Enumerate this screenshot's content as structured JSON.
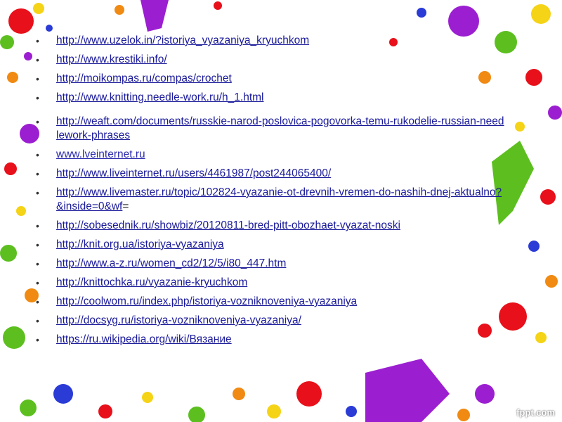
{
  "links": [
    {
      "text": "http://www.uzelok.in/?istoriya_vyazaniya_kryuchkom",
      "suffix": ""
    },
    {
      "text": "http://www.krestiki.info/",
      "suffix": ""
    },
    {
      "text": "http://moikompas.ru/compas/crochet",
      "suffix": ""
    },
    {
      "text": "http://www.knitting.needle-work.ru/h_1.html",
      "suffix": ""
    },
    {
      "text": "http://weaft.com/documents/russkie-narod-poslovica-pogovorka-temu-rukodelie-russian-needlework-phrases",
      "suffix": ""
    },
    {
      "text": "www.lveinternet.ru",
      "suffix": ""
    },
    {
      "text": "http://www.liveinternet.ru/users/4461987/post244065400/",
      "suffix": ""
    },
    {
      "text": "http://www.livemaster.ru/topic/102824-vyazanie-ot-drevnih-vremen-do-nashih-dnej-aktualno?&inside=0&wf",
      "suffix": "="
    },
    {
      "text": "http://sobesednik.ru/showbiz/20120811-bred-pitt-obozhaet-vyazat-noski",
      "suffix": ""
    },
    {
      "text": "http://knit.org.ua/istoriya-vyazaniya",
      "suffix": ""
    },
    {
      "text": "http://www.a-z.ru/women_cd2/12/5/i80_447.htm",
      "suffix": ""
    },
    {
      "text": "http://knittochka.ru/vyazanie-kryuchkom",
      "suffix": ""
    },
    {
      "text": "http://coolwom.ru/index.php/istoriya-vozniknoveniya-vyazaniya",
      "suffix": ""
    },
    {
      "text": "http://docsyg.ru/istoriya-vozniknoveniya-vyazaniya/",
      "suffix": ""
    },
    {
      "text": "https://ru.wikipedia.org/wiki/Вязание",
      "suffix": ""
    }
  ],
  "watermark": "fppt.com",
  "colors": {
    "link": "#1a1a9a",
    "splash_purple": "#9b1fd1",
    "splash_red": "#e8101a",
    "splash_green": "#5cbf1f",
    "splash_yellow": "#f5d316",
    "splash_orange": "#f08a12",
    "splash_blue": "#2a3bd6"
  }
}
